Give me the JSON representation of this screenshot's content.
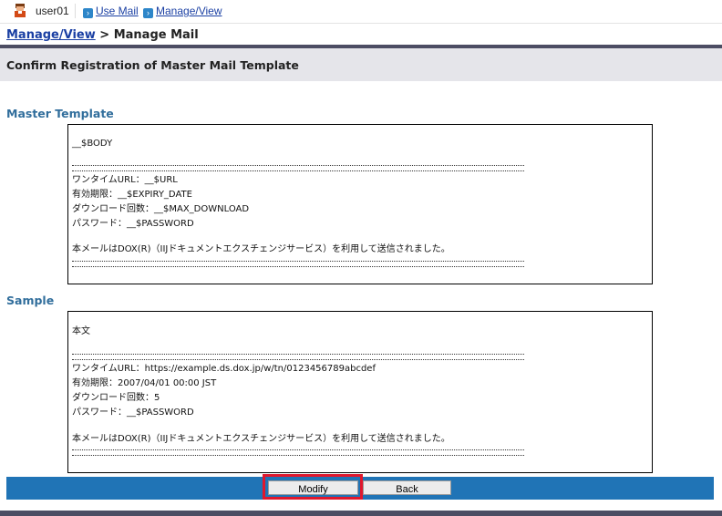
{
  "topbar": {
    "user": "user01",
    "links": [
      "Use Mail",
      "Manage/View"
    ]
  },
  "breadcrumb": {
    "parent": "Manage/View",
    "separator": ">",
    "current": "Manage Mail"
  },
  "page_title": "Confirm Registration of Master Mail Template",
  "master_template": {
    "label": "Master Template",
    "lines": [
      "__$BODY",
      "",
      "=====",
      "ワンタイムURL：__$URL",
      "有効期限：__$EXPIRY_DATE",
      "ダウンロード回数：__$MAX_DOWNLOAD",
      "パスワード：__$PASSWORD",
      "",
      "本メールはDOX(R)（IIJドキュメントエクスチェンジサービス）を利用して送信されました。",
      "====="
    ]
  },
  "sample": {
    "label": "Sample",
    "lines": [
      "本文",
      "",
      "=====",
      "ワンタイムURL：https://example.ds.dox.jp/w/tn/0123456789abcdef",
      "有効期限：2007/04/01 00:00 JST",
      "ダウンロード回数：5",
      "パスワード：__$PASSWORD",
      "",
      "本メールはDOX(R)（IIJドキュメントエクスチェンジサービス）を利用して送信されました。",
      "====="
    ]
  },
  "buttons": {
    "modify": "Modify",
    "back": "Back"
  },
  "colors": {
    "accent_bar": "#2074b6",
    "section_label": "#316e9c",
    "highlight": "#e0182d",
    "dark_rule": "#4c4d63"
  },
  "icons": {
    "user": "user-icon",
    "link": "arrow-right-icon"
  }
}
